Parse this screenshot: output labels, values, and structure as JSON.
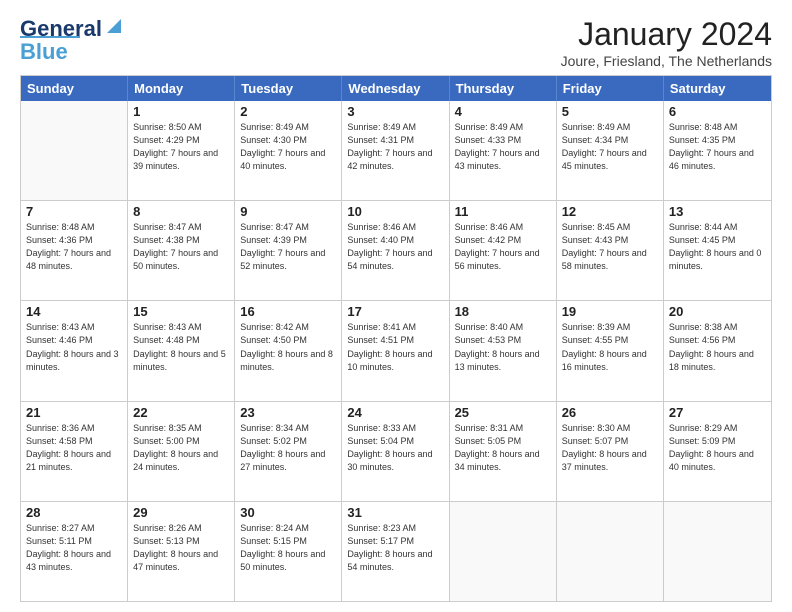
{
  "header": {
    "logo_general": "General",
    "logo_blue": "Blue",
    "month": "January 2024",
    "location": "Joure, Friesland, The Netherlands"
  },
  "days": [
    "Sunday",
    "Monday",
    "Tuesday",
    "Wednesday",
    "Thursday",
    "Friday",
    "Saturday"
  ],
  "rows": [
    [
      {
        "day": "",
        "sunrise": "",
        "sunset": "",
        "daylight": ""
      },
      {
        "day": "1",
        "sunrise": "Sunrise: 8:50 AM",
        "sunset": "Sunset: 4:29 PM",
        "daylight": "Daylight: 7 hours and 39 minutes."
      },
      {
        "day": "2",
        "sunrise": "Sunrise: 8:49 AM",
        "sunset": "Sunset: 4:30 PM",
        "daylight": "Daylight: 7 hours and 40 minutes."
      },
      {
        "day": "3",
        "sunrise": "Sunrise: 8:49 AM",
        "sunset": "Sunset: 4:31 PM",
        "daylight": "Daylight: 7 hours and 42 minutes."
      },
      {
        "day": "4",
        "sunrise": "Sunrise: 8:49 AM",
        "sunset": "Sunset: 4:33 PM",
        "daylight": "Daylight: 7 hours and 43 minutes."
      },
      {
        "day": "5",
        "sunrise": "Sunrise: 8:49 AM",
        "sunset": "Sunset: 4:34 PM",
        "daylight": "Daylight: 7 hours and 45 minutes."
      },
      {
        "day": "6",
        "sunrise": "Sunrise: 8:48 AM",
        "sunset": "Sunset: 4:35 PM",
        "daylight": "Daylight: 7 hours and 46 minutes."
      }
    ],
    [
      {
        "day": "7",
        "sunrise": "Sunrise: 8:48 AM",
        "sunset": "Sunset: 4:36 PM",
        "daylight": "Daylight: 7 hours and 48 minutes."
      },
      {
        "day": "8",
        "sunrise": "Sunrise: 8:47 AM",
        "sunset": "Sunset: 4:38 PM",
        "daylight": "Daylight: 7 hours and 50 minutes."
      },
      {
        "day": "9",
        "sunrise": "Sunrise: 8:47 AM",
        "sunset": "Sunset: 4:39 PM",
        "daylight": "Daylight: 7 hours and 52 minutes."
      },
      {
        "day": "10",
        "sunrise": "Sunrise: 8:46 AM",
        "sunset": "Sunset: 4:40 PM",
        "daylight": "Daylight: 7 hours and 54 minutes."
      },
      {
        "day": "11",
        "sunrise": "Sunrise: 8:46 AM",
        "sunset": "Sunset: 4:42 PM",
        "daylight": "Daylight: 7 hours and 56 minutes."
      },
      {
        "day": "12",
        "sunrise": "Sunrise: 8:45 AM",
        "sunset": "Sunset: 4:43 PM",
        "daylight": "Daylight: 7 hours and 58 minutes."
      },
      {
        "day": "13",
        "sunrise": "Sunrise: 8:44 AM",
        "sunset": "Sunset: 4:45 PM",
        "daylight": "Daylight: 8 hours and 0 minutes."
      }
    ],
    [
      {
        "day": "14",
        "sunrise": "Sunrise: 8:43 AM",
        "sunset": "Sunset: 4:46 PM",
        "daylight": "Daylight: 8 hours and 3 minutes."
      },
      {
        "day": "15",
        "sunrise": "Sunrise: 8:43 AM",
        "sunset": "Sunset: 4:48 PM",
        "daylight": "Daylight: 8 hours and 5 minutes."
      },
      {
        "day": "16",
        "sunrise": "Sunrise: 8:42 AM",
        "sunset": "Sunset: 4:50 PM",
        "daylight": "Daylight: 8 hours and 8 minutes."
      },
      {
        "day": "17",
        "sunrise": "Sunrise: 8:41 AM",
        "sunset": "Sunset: 4:51 PM",
        "daylight": "Daylight: 8 hours and 10 minutes."
      },
      {
        "day": "18",
        "sunrise": "Sunrise: 8:40 AM",
        "sunset": "Sunset: 4:53 PM",
        "daylight": "Daylight: 8 hours and 13 minutes."
      },
      {
        "day": "19",
        "sunrise": "Sunrise: 8:39 AM",
        "sunset": "Sunset: 4:55 PM",
        "daylight": "Daylight: 8 hours and 16 minutes."
      },
      {
        "day": "20",
        "sunrise": "Sunrise: 8:38 AM",
        "sunset": "Sunset: 4:56 PM",
        "daylight": "Daylight: 8 hours and 18 minutes."
      }
    ],
    [
      {
        "day": "21",
        "sunrise": "Sunrise: 8:36 AM",
        "sunset": "Sunset: 4:58 PM",
        "daylight": "Daylight: 8 hours and 21 minutes."
      },
      {
        "day": "22",
        "sunrise": "Sunrise: 8:35 AM",
        "sunset": "Sunset: 5:00 PM",
        "daylight": "Daylight: 8 hours and 24 minutes."
      },
      {
        "day": "23",
        "sunrise": "Sunrise: 8:34 AM",
        "sunset": "Sunset: 5:02 PM",
        "daylight": "Daylight: 8 hours and 27 minutes."
      },
      {
        "day": "24",
        "sunrise": "Sunrise: 8:33 AM",
        "sunset": "Sunset: 5:04 PM",
        "daylight": "Daylight: 8 hours and 30 minutes."
      },
      {
        "day": "25",
        "sunrise": "Sunrise: 8:31 AM",
        "sunset": "Sunset: 5:05 PM",
        "daylight": "Daylight: 8 hours and 34 minutes."
      },
      {
        "day": "26",
        "sunrise": "Sunrise: 8:30 AM",
        "sunset": "Sunset: 5:07 PM",
        "daylight": "Daylight: 8 hours and 37 minutes."
      },
      {
        "day": "27",
        "sunrise": "Sunrise: 8:29 AM",
        "sunset": "Sunset: 5:09 PM",
        "daylight": "Daylight: 8 hours and 40 minutes."
      }
    ],
    [
      {
        "day": "28",
        "sunrise": "Sunrise: 8:27 AM",
        "sunset": "Sunset: 5:11 PM",
        "daylight": "Daylight: 8 hours and 43 minutes."
      },
      {
        "day": "29",
        "sunrise": "Sunrise: 8:26 AM",
        "sunset": "Sunset: 5:13 PM",
        "daylight": "Daylight: 8 hours and 47 minutes."
      },
      {
        "day": "30",
        "sunrise": "Sunrise: 8:24 AM",
        "sunset": "Sunset: 5:15 PM",
        "daylight": "Daylight: 8 hours and 50 minutes."
      },
      {
        "day": "31",
        "sunrise": "Sunrise: 8:23 AM",
        "sunset": "Sunset: 5:17 PM",
        "daylight": "Daylight: 8 hours and 54 minutes."
      },
      {
        "day": "",
        "sunrise": "",
        "sunset": "",
        "daylight": ""
      },
      {
        "day": "",
        "sunrise": "",
        "sunset": "",
        "daylight": ""
      },
      {
        "day": "",
        "sunrise": "",
        "sunset": "",
        "daylight": ""
      }
    ]
  ]
}
